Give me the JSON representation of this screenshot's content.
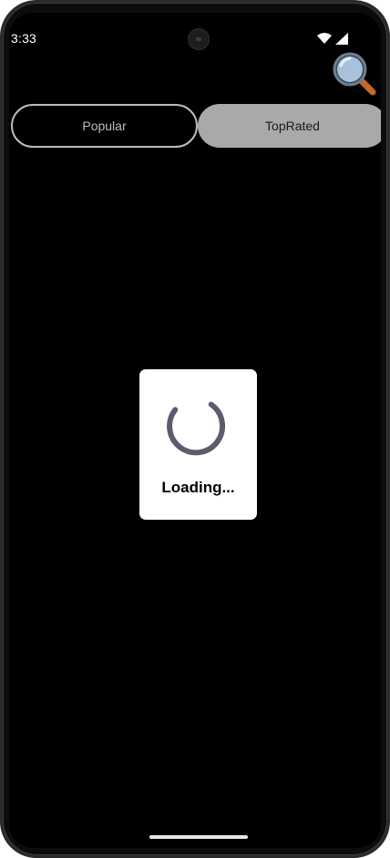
{
  "status_bar": {
    "time": "3:33",
    "icons": [
      "wifi-icon",
      "cellular-signal-icon"
    ]
  },
  "header": {
    "search_icon": "magnifying-glass-icon"
  },
  "tabs": [
    {
      "label": "Popular",
      "selected": false
    },
    {
      "label": "TopRated",
      "selected": true
    }
  ],
  "loading": {
    "text": "Loading...",
    "spinner_color": "#5f5b6e"
  },
  "colors": {
    "background": "#000000",
    "tab_outline": "#bdbdbd",
    "tab_selected_bg": "#a9a9a9",
    "dialog_bg": "#ffffff"
  }
}
